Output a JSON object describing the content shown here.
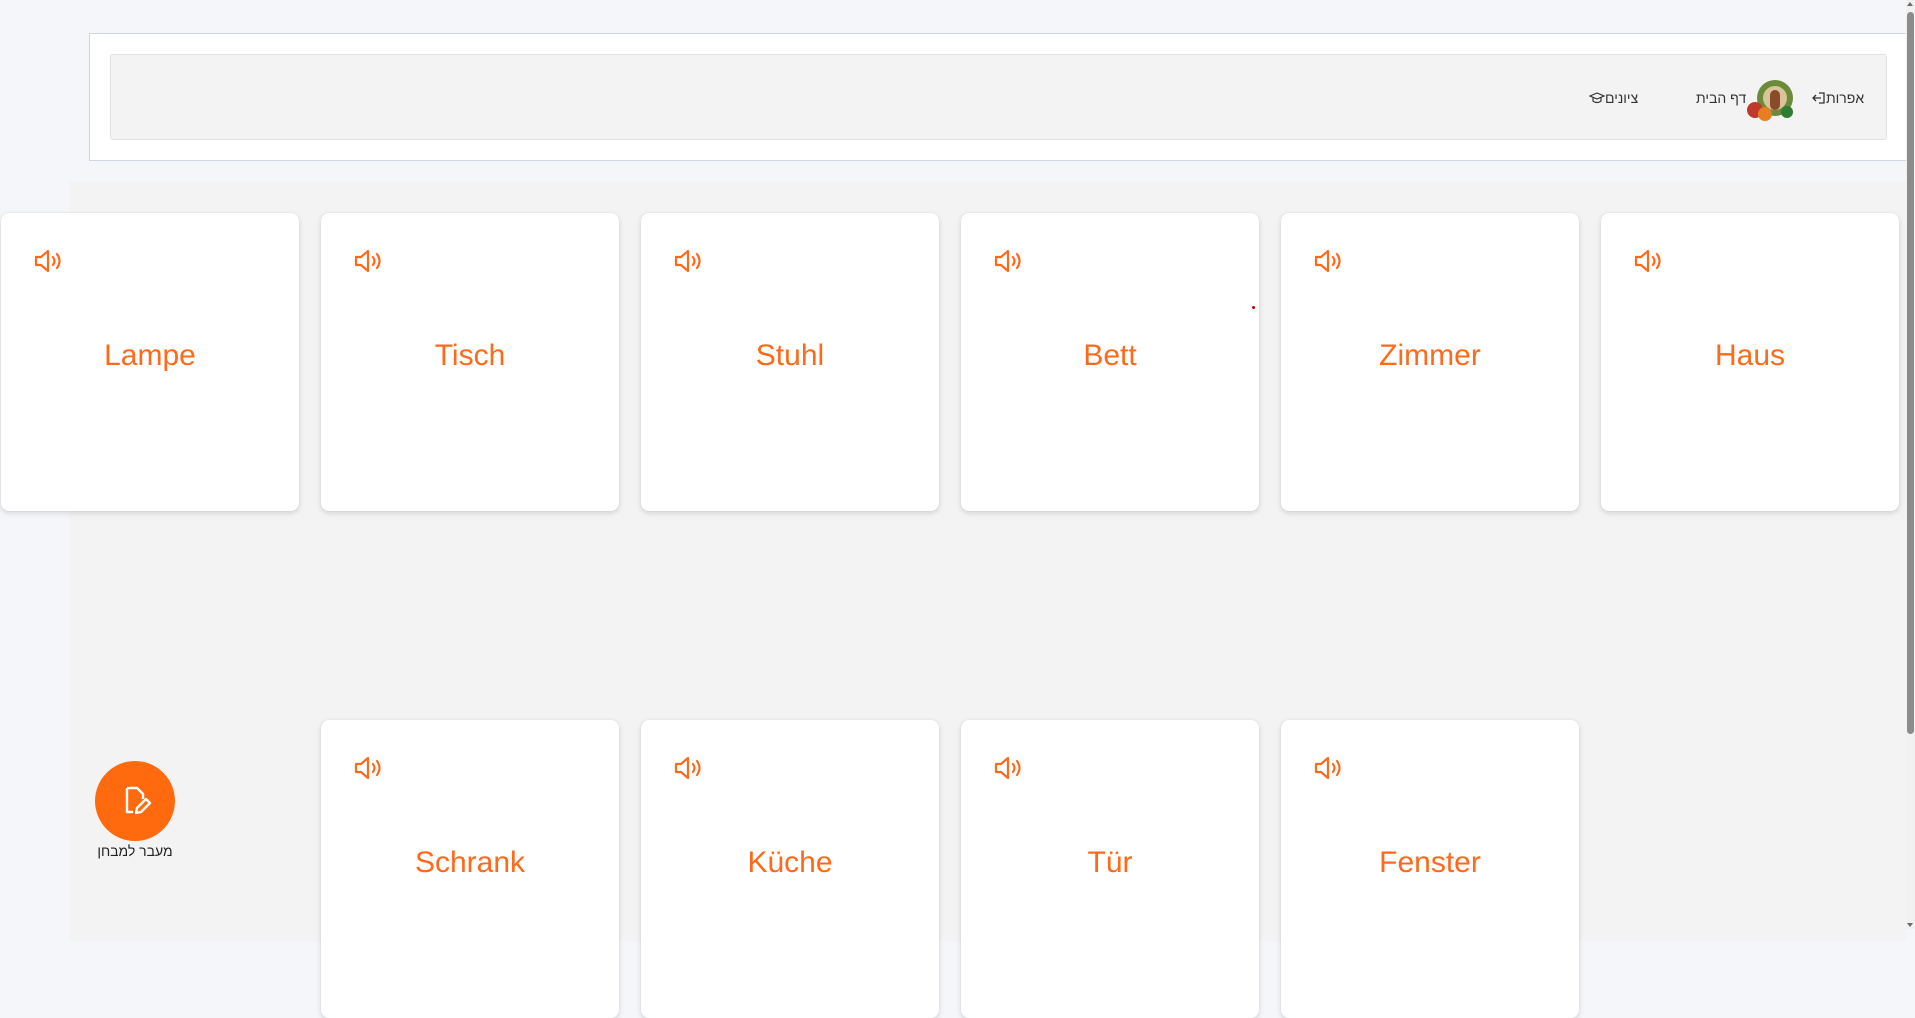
{
  "nav": {
    "logout_label": "אפרות",
    "home_label": "דף הבית",
    "grades_label": "ציונים"
  },
  "cards": [
    {
      "word": "Lampe",
      "icon": "speaker-icon"
    },
    {
      "word": "Tisch",
      "icon": "speaker-icon"
    },
    {
      "word": "Stuhl",
      "icon": "speaker-icon"
    },
    {
      "word": "Bett",
      "icon": "speaker-icon"
    },
    {
      "word": "Zimmer",
      "icon": "speaker-icon"
    },
    {
      "word": "Haus",
      "icon": "speaker-icon"
    },
    {
      "word": "Schrank",
      "icon": "speaker-icon"
    },
    {
      "word": "Küche",
      "icon": "speaker-icon"
    },
    {
      "word": "Tür",
      "icon": "speaker-icon"
    },
    {
      "word": "Fenster",
      "icon": "speaker-icon"
    }
  ],
  "fab": {
    "label": "מעבר למבחן",
    "icon": "edit-file-icon"
  },
  "colors": {
    "accent": "#ff6a1a",
    "fab": "#ff6a0f",
    "background": "#f4f6f9"
  }
}
